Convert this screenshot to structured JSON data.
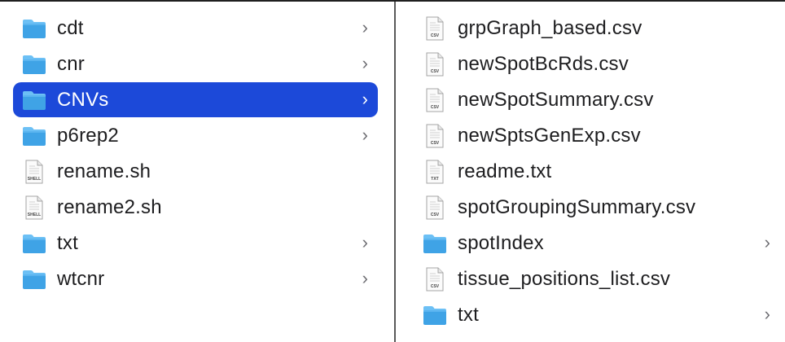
{
  "colors": {
    "selection": "#1c49d9",
    "folder_body": "#3fa3e6",
    "folder_top": "#6cc0f5",
    "chevron": "#6e6e73"
  },
  "left_column": {
    "items": [
      {
        "name": "cdt",
        "kind": "folder",
        "has_children": true,
        "selected": false
      },
      {
        "name": "cnr",
        "kind": "folder",
        "has_children": true,
        "selected": false
      },
      {
        "name": "CNVs",
        "kind": "folder",
        "has_children": true,
        "selected": true
      },
      {
        "name": "p6rep2",
        "kind": "folder",
        "has_children": true,
        "selected": false
      },
      {
        "name": "rename.sh",
        "kind": "file",
        "file_badge": "SHELL",
        "selected": false
      },
      {
        "name": "rename2.sh",
        "kind": "file",
        "file_badge": "SHELL",
        "selected": false
      },
      {
        "name": "txt",
        "kind": "folder",
        "has_children": true,
        "selected": false
      },
      {
        "name": "wtcnr",
        "kind": "folder",
        "has_children": true,
        "selected": false
      }
    ]
  },
  "right_column": {
    "items": [
      {
        "name": "grpGraph_based.csv",
        "kind": "file",
        "file_badge": "CSV"
      },
      {
        "name": "newSpotBcRds.csv",
        "kind": "file",
        "file_badge": "CSV"
      },
      {
        "name": "newSpotSummary.csv",
        "kind": "file",
        "file_badge": "CSV"
      },
      {
        "name": "newSptsGenExp.csv",
        "kind": "file",
        "file_badge": "CSV"
      },
      {
        "name": "readme.txt",
        "kind": "file",
        "file_badge": "TXT"
      },
      {
        "name": "spotGroupingSummary.csv",
        "kind": "file",
        "file_badge": "CSV"
      },
      {
        "name": "spotIndex",
        "kind": "folder",
        "has_children": true
      },
      {
        "name": "tissue_positions_list.csv",
        "kind": "file",
        "file_badge": "CSV"
      },
      {
        "name": "txt",
        "kind": "folder",
        "has_children": true
      }
    ]
  },
  "chevron_glyph": "›"
}
